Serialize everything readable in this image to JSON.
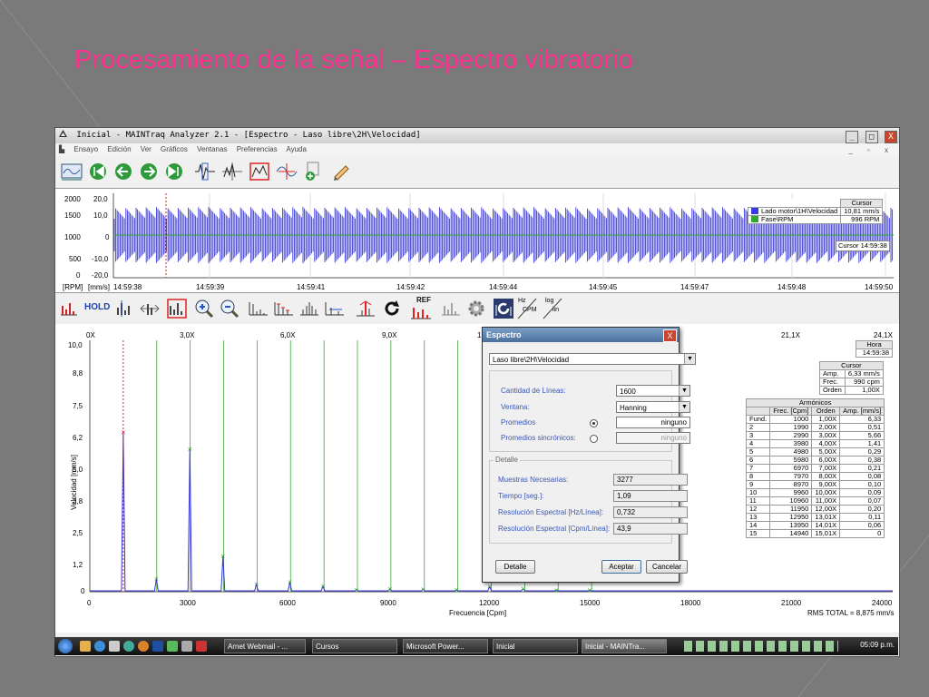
{
  "slide": {
    "title": "Procesamiento de la señal – Espectro vibratorio"
  },
  "window": {
    "title": "Inicial - MAINTraq Analyzer 2.1 - [Espectro - Laso libre\\2H\\Velocidad]",
    "minimize": "_",
    "maximize": "□",
    "close": "X"
  },
  "menu": {
    "items": [
      "Ensayo",
      "Edición",
      "Ver",
      "Gráficos",
      "Ventanas",
      "Preferencias",
      "Ayuda"
    ]
  },
  "mdi": {
    "minimize": "_",
    "restore": "▫",
    "close": "x"
  },
  "toolbar1": {
    "icons": [
      "report-icon",
      "first-icon",
      "prev-icon",
      "next-icon",
      "last-icon",
      "waveform-tool-icon",
      "move-cursor-icon",
      "zoom-box-icon",
      "cursor-cross-icon",
      "add-signal-icon",
      "pencil-icon"
    ]
  },
  "time_pane": {
    "y_left_units": "[RPM]",
    "y_right_units": "[mm/s]",
    "start_time": "14:59:38",
    "rpm_ticks": [
      "2000",
      "1500",
      "1000",
      "500",
      "0"
    ],
    "vel_ticks": [
      "20,0",
      "10,0",
      "0",
      "-10,0",
      "-20,0"
    ],
    "x_ticks": [
      "14:59:39",
      "14:59:41",
      "14:59:42",
      "14:59:44",
      "14:59:45",
      "14:59:47",
      "14:59:48",
      "14:59:50"
    ],
    "legend": {
      "header": "Cursor",
      "rows": [
        {
          "name": "Lado motor\\1H\\Velocidad",
          "value": "10,81 mm/s",
          "color": "#3a3ae0"
        },
        {
          "name": "Fase\\RPM",
          "value": "996 RPM",
          "color": "#2faa2f"
        }
      ]
    },
    "cursor_label": "Cursor 14:59:38"
  },
  "toolbar2": {
    "hold": "HOLD",
    "ref": "REF",
    "hz": "Hz",
    "cpm": "CPM",
    "log": "log",
    "lin": "lin"
  },
  "spectrum": {
    "y_label": "Velocidad [mm/s]",
    "y_ticks": [
      "10,0",
      "8,8",
      "7,5",
      "6,2",
      "5,0",
      "3,8",
      "2,5",
      "1,2",
      "0"
    ],
    "x_label": "Frecuencia [Cpm]",
    "x_ticks": [
      "0",
      "3000",
      "6000",
      "9000",
      "12000",
      "15000",
      "18000",
      "21000",
      "24000"
    ],
    "order_ticks": [
      "0X",
      "3,0X",
      "6,0X",
      "9,0X",
      "12,0X",
      "21,1X",
      "24,1X"
    ],
    "rms_total": "RMS TOTAL = 8,875 mm/s"
  },
  "chart_data": {
    "type": "line",
    "xlabel": "Frecuencia [Cpm]",
    "ylabel": "Velocidad [mm/s]",
    "xlim": [
      0,
      24000
    ],
    "ylim": [
      0,
      10
    ],
    "peaks": [
      {
        "x": 1000,
        "y": 6.33
      },
      {
        "x": 1990,
        "y": 0.51
      },
      {
        "x": 2990,
        "y": 5.66
      },
      {
        "x": 3980,
        "y": 1.41
      },
      {
        "x": 4980,
        "y": 0.29
      },
      {
        "x": 5980,
        "y": 0.38
      },
      {
        "x": 6970,
        "y": 0.21
      },
      {
        "x": 7970,
        "y": 0.08
      },
      {
        "x": 8970,
        "y": 0.1
      },
      {
        "x": 9960,
        "y": 0.09
      },
      {
        "x": 10960,
        "y": 0.07
      },
      {
        "x": 11950,
        "y": 0.2
      },
      {
        "x": 12950,
        "y": 0.11
      },
      {
        "x": 13950,
        "y": 0.06
      },
      {
        "x": 14940,
        "y": 0
      }
    ]
  },
  "hora": {
    "header": "Hora",
    "value": "14:59:38"
  },
  "cursor_table": {
    "header": "Cursor",
    "rows": [
      [
        "Amp.",
        "6,33 mm/s"
      ],
      [
        "Frec.",
        "990 cpm"
      ],
      [
        "Orden",
        "1,00X"
      ]
    ]
  },
  "armonicos": {
    "header": "Armónicos",
    "cols": [
      "",
      "Frec. [Cpm]",
      "Orden",
      "Amp. [mm/s]"
    ],
    "rows": [
      [
        "Fund.",
        "1000",
        "1,00X",
        "6,33"
      ],
      [
        "2",
        "1990",
        "2,00X",
        "0,51"
      ],
      [
        "3",
        "2990",
        "3,00X",
        "5,66"
      ],
      [
        "4",
        "3980",
        "4,00X",
        "1,41"
      ],
      [
        "5",
        "4980",
        "5,00X",
        "0,29"
      ],
      [
        "6",
        "5980",
        "6,00X",
        "0,38"
      ],
      [
        "7",
        "6970",
        "7,00X",
        "0,21"
      ],
      [
        "8",
        "7970",
        "8,00X",
        "0,08"
      ],
      [
        "9",
        "8970",
        "9,00X",
        "0,10"
      ],
      [
        "10",
        "9960",
        "10,00X",
        "0,09"
      ],
      [
        "11",
        "10960",
        "11,00X",
        "0,07"
      ],
      [
        "12",
        "11950",
        "12,00X",
        "0,20"
      ],
      [
        "13",
        "12950",
        "13,01X",
        "0,11"
      ],
      [
        "14",
        "13950",
        "14,01X",
        "0,06"
      ],
      [
        "15",
        "14940",
        "15,01X",
        "0"
      ]
    ]
  },
  "dialog": {
    "title": "Espectro",
    "close": "X",
    "signal": "Laso libre\\2H\\Velocidad",
    "lineas_label": "Cantidad de Líneas:",
    "lineas_value": "1600",
    "ventana_label": "Ventana:",
    "ventana_value": "Hanning",
    "promedios_label": "Promedios",
    "promedios_value": "ninguno",
    "promedios_sinc_label": "Promedios sincrónicos:",
    "promedios_sinc_value": "ninguno",
    "detalle_label": "Detalle",
    "muestras_label": "Muestras Necesarias:",
    "muestras_value": "3277",
    "tiempo_label": "Tiempo [seg.]:",
    "tiempo_value": "1,09",
    "res_hz_label": "Resolución Espectral [Hz/Línea]:",
    "res_hz_value": "0,732",
    "res_cpm_label": "Resolución Espectral [Cpm/Línea]:",
    "res_cpm_value": "43,9",
    "btn_detalle": "Detalle",
    "btn_aceptar": "Aceptar",
    "btn_cancelar": "Cancelar"
  },
  "taskbar": {
    "tasks": [
      {
        "label": "Arnet Webmail - ..."
      },
      {
        "label": "Cursos"
      },
      {
        "label": "Microsoft Power..."
      },
      {
        "label": "Inicial"
      },
      {
        "label": "Inicial - MAINTra..."
      }
    ],
    "clock": "05:09 p.m."
  }
}
